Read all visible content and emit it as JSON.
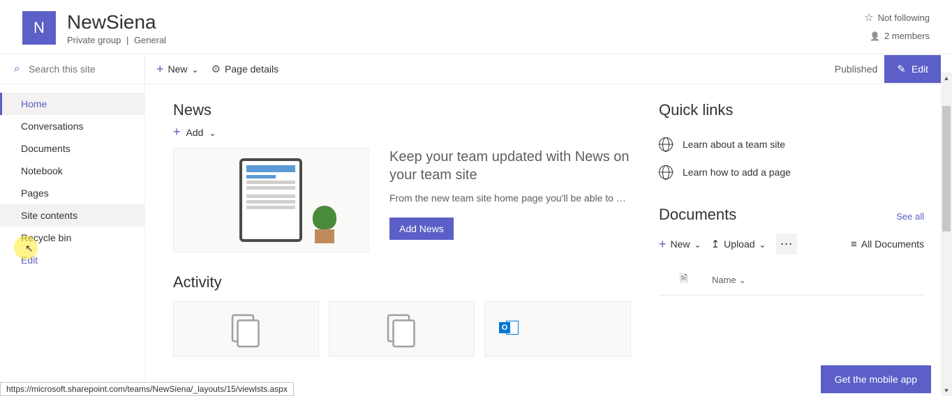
{
  "site": {
    "logo_letter": "N",
    "title": "NewSiena",
    "group_type": "Private group",
    "group_sep": " | ",
    "channel": "General"
  },
  "header_right": {
    "follow_label": "Not following",
    "members_label": "2 members"
  },
  "search": {
    "placeholder": "Search this site"
  },
  "cmdbar": {
    "new_label": "New",
    "page_details_label": "Page details",
    "published_label": "Published",
    "edit_label": "Edit"
  },
  "nav": {
    "items": [
      "Home",
      "Conversations",
      "Documents",
      "Notebook",
      "Pages",
      "Site contents",
      "Recycle bin"
    ],
    "edit_label": "Edit"
  },
  "news": {
    "title": "News",
    "add_label": "Add",
    "headline": "Keep your team updated with News on your team site",
    "desc": "From the new team site home page you'll be able to quic...",
    "button": "Add News"
  },
  "activity": {
    "title": "Activity"
  },
  "quicklinks": {
    "title": "Quick links",
    "items": [
      "Learn about a team site",
      "Learn how to add a page"
    ]
  },
  "documents": {
    "title": "Documents",
    "see_all": "See all",
    "new_label": "New",
    "upload_label": "Upload",
    "all_docs_label": "All Documents",
    "col_name": "Name"
  },
  "mobile_btn": "Get the mobile app",
  "status_url": "https://microsoft.sharepoint.com/teams/NewSiena/_layouts/15/viewlsts.aspx"
}
